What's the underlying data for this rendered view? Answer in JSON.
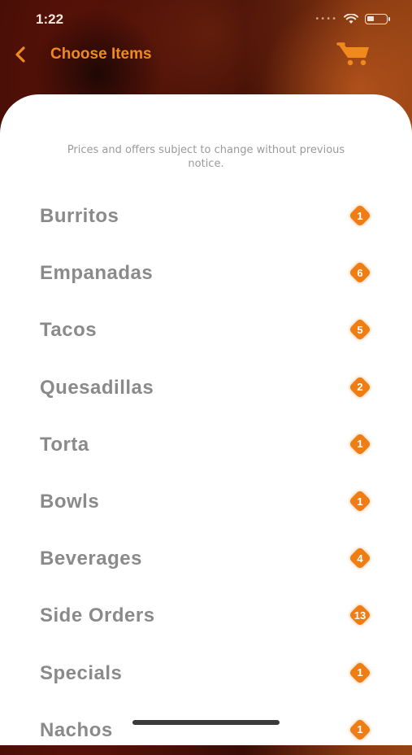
{
  "status_bar": {
    "time": "1:22"
  },
  "nav": {
    "title": "Choose Items",
    "back_icon": "chevron-left-icon",
    "cart_icon": "shopping-cart-icon"
  },
  "notice": "Prices and offers subject to change without previous notice.",
  "colors": {
    "accent": "#ee7d14",
    "label": "#8a8a8a"
  },
  "categories": [
    {
      "label": "Burritos",
      "count": "1"
    },
    {
      "label": "Empanadas",
      "count": "6"
    },
    {
      "label": "Tacos",
      "count": "5"
    },
    {
      "label": "Quesadillas",
      "count": "2"
    },
    {
      "label": "Torta",
      "count": "1"
    },
    {
      "label": "Bowls",
      "count": "1"
    },
    {
      "label": "Beverages",
      "count": "4"
    },
    {
      "label": "Side Orders",
      "count": "13"
    },
    {
      "label": "Specials",
      "count": "1"
    },
    {
      "label": "Nachos",
      "count": "1"
    }
  ]
}
